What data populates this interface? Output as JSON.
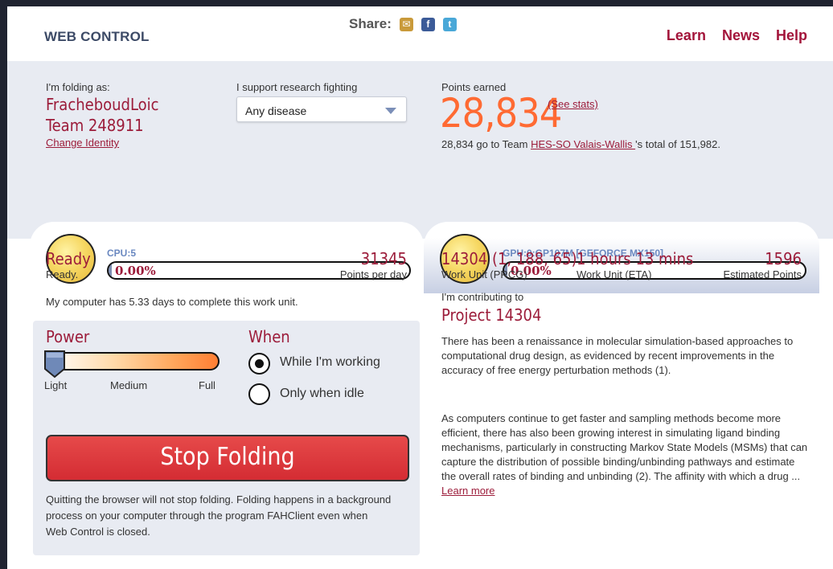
{
  "header": {
    "brand": "WEB CONTROL",
    "share_label": "Share:",
    "nav": [
      "Learn",
      "News",
      "Help"
    ]
  },
  "identity": {
    "folding_as_label": "I'm folding as:",
    "user": "FracheboudLoic",
    "team": "Team 248911",
    "change_identity": "Change Identity",
    "support_label": "I support research fighting",
    "cause": "Any disease"
  },
  "points": {
    "label": "Points earned",
    "value": "28,834",
    "see_stats": "(See stats)",
    "team_line_prefix": "28,834 go to Team ",
    "team_link": "HES-SO Valais-Wallis ",
    "team_line_suffix": "'s total of 151,982."
  },
  "slots": {
    "cpu": {
      "label": "CPU:5",
      "progress": "0.00%",
      "progress_fraction": 0.0
    },
    "gpu": {
      "label": "GPU:0:GP107M [GEFORCE MX150]",
      "progress": "0.00%",
      "progress_fraction": 0.0
    }
  },
  "status": {
    "title": "Ready",
    "sub": "Ready.",
    "ppd": "31345",
    "ppd_label": "Points per day",
    "days_text": "My computer has 5.33 days to complete this work unit."
  },
  "power": {
    "title": "Power",
    "level": "Light",
    "level_fraction": 0.0,
    "levels": [
      "Light",
      "Medium",
      "Full"
    ],
    "when_title": "When",
    "options": [
      "While I'm working",
      "Only when idle"
    ],
    "selected": "While I'm working",
    "stop_button": "Stop Folding",
    "quit_text": "Quitting the browser will not stop folding. Folding happens in a background process on your computer through the program FAHClient even when Web Control is closed."
  },
  "work_unit": {
    "id": "14304 (1, 188, 65)",
    "id_label": "Work Unit (PRCG)",
    "eta": "1 hours 13 mins",
    "eta_label": "Work Unit (ETA)",
    "est_points": "1596",
    "est_points_label": "Estimated Points",
    "contrib_label": "I'm contributing to",
    "project": "Project 14304",
    "para1": "There has been a renaissance in molecular simulation-based approaches to computational drug design, as evidenced by recent improvements in the accuracy of free energy perturbation methods (1).",
    "para2": "As computers continue to get faster and sampling methods become more efficient, there has also been growing interest in simulating ligand binding mechanisms, particularly in constructing Markov State Models (MSMs) that can capture the distribution of possible binding/unbinding pathways and estimate the overall rates of binding and unbinding (2).  The affinity with which a drug ... ",
    "learn_more": "Learn more"
  },
  "colors": {
    "accent": "#9c1c3a",
    "points": "#ff6a33",
    "band": "#e8ebf2",
    "stop": "#d42c33"
  }
}
